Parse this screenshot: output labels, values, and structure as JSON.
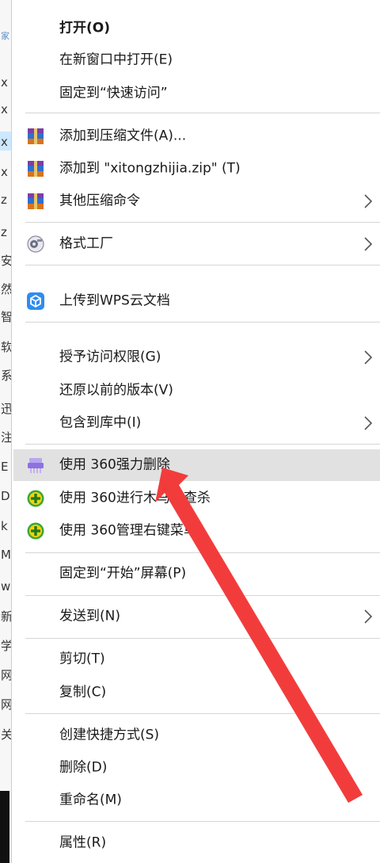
{
  "background_window": {
    "fragments": [
      "家",
      "x",
      "x",
      "x",
      "x",
      "z",
      "z",
      "安",
      "然",
      "智",
      "软",
      "系",
      "迅",
      "注",
      "E",
      "D",
      "k",
      "M",
      "w",
      "新",
      "学",
      "网",
      "网",
      "关"
    ]
  },
  "menu": {
    "items": [
      {
        "id": "open",
        "label": "打开(O)",
        "bold": true
      },
      {
        "id": "open-new-window",
        "label": "在新窗口中打开(E)"
      },
      {
        "id": "pin-quick-access",
        "label": "固定到“快速访问”"
      },
      {
        "id": "add-to-archive",
        "label": "添加到压缩文件(A)...",
        "icon": "winrar-icon"
      },
      {
        "id": "add-to-zip",
        "label": "添加到 \"xitongzhijia.zip\" (T)",
        "icon": "winrar-icon"
      },
      {
        "id": "other-compress",
        "label": "其他压缩命令",
        "icon": "winrar-icon",
        "submenu": true
      },
      {
        "id": "format-factory",
        "label": "格式工厂",
        "icon": "format-factory-icon",
        "submenu": true
      },
      {
        "id": "upload-wps",
        "label": "上传到WPS云文档",
        "icon": "wps-cloud-icon"
      },
      {
        "id": "grant-access",
        "label": "授予访问权限(G)",
        "submenu": true
      },
      {
        "id": "restore-versions",
        "label": "还原以前的版本(V)"
      },
      {
        "id": "include-library",
        "label": "包含到库中(I)",
        "submenu": true
      },
      {
        "id": "force-delete-360",
        "label": "使用 360强力删除",
        "icon": "shredder-icon",
        "highlighted": true
      },
      {
        "id": "trojan-scan-360",
        "label": "使用 360进行木马云查杀",
        "icon": "plus-360-icon"
      },
      {
        "id": "manage-menu-360",
        "label": "使用 360管理右键菜单",
        "icon": "plus-360-icon"
      },
      {
        "id": "pin-start",
        "label": "固定到“开始”屏幕(P)"
      },
      {
        "id": "send-to",
        "label": "发送到(N)",
        "submenu": true
      },
      {
        "id": "cut",
        "label": "剪切(T)"
      },
      {
        "id": "copy",
        "label": "复制(C)"
      },
      {
        "id": "create-shortcut",
        "label": "创建快捷方式(S)"
      },
      {
        "id": "delete",
        "label": "删除(D)"
      },
      {
        "id": "rename",
        "label": "重命名(M)"
      },
      {
        "id": "properties",
        "label": "属性(R)"
      }
    ]
  },
  "colors": {
    "highlight": "#e1e1e1",
    "annotation_arrow": "#f23c3c",
    "wps_blue": "#2f8cf0",
    "plus_green": "#3aa63a",
    "plus_yellow": "#f5d20a"
  }
}
